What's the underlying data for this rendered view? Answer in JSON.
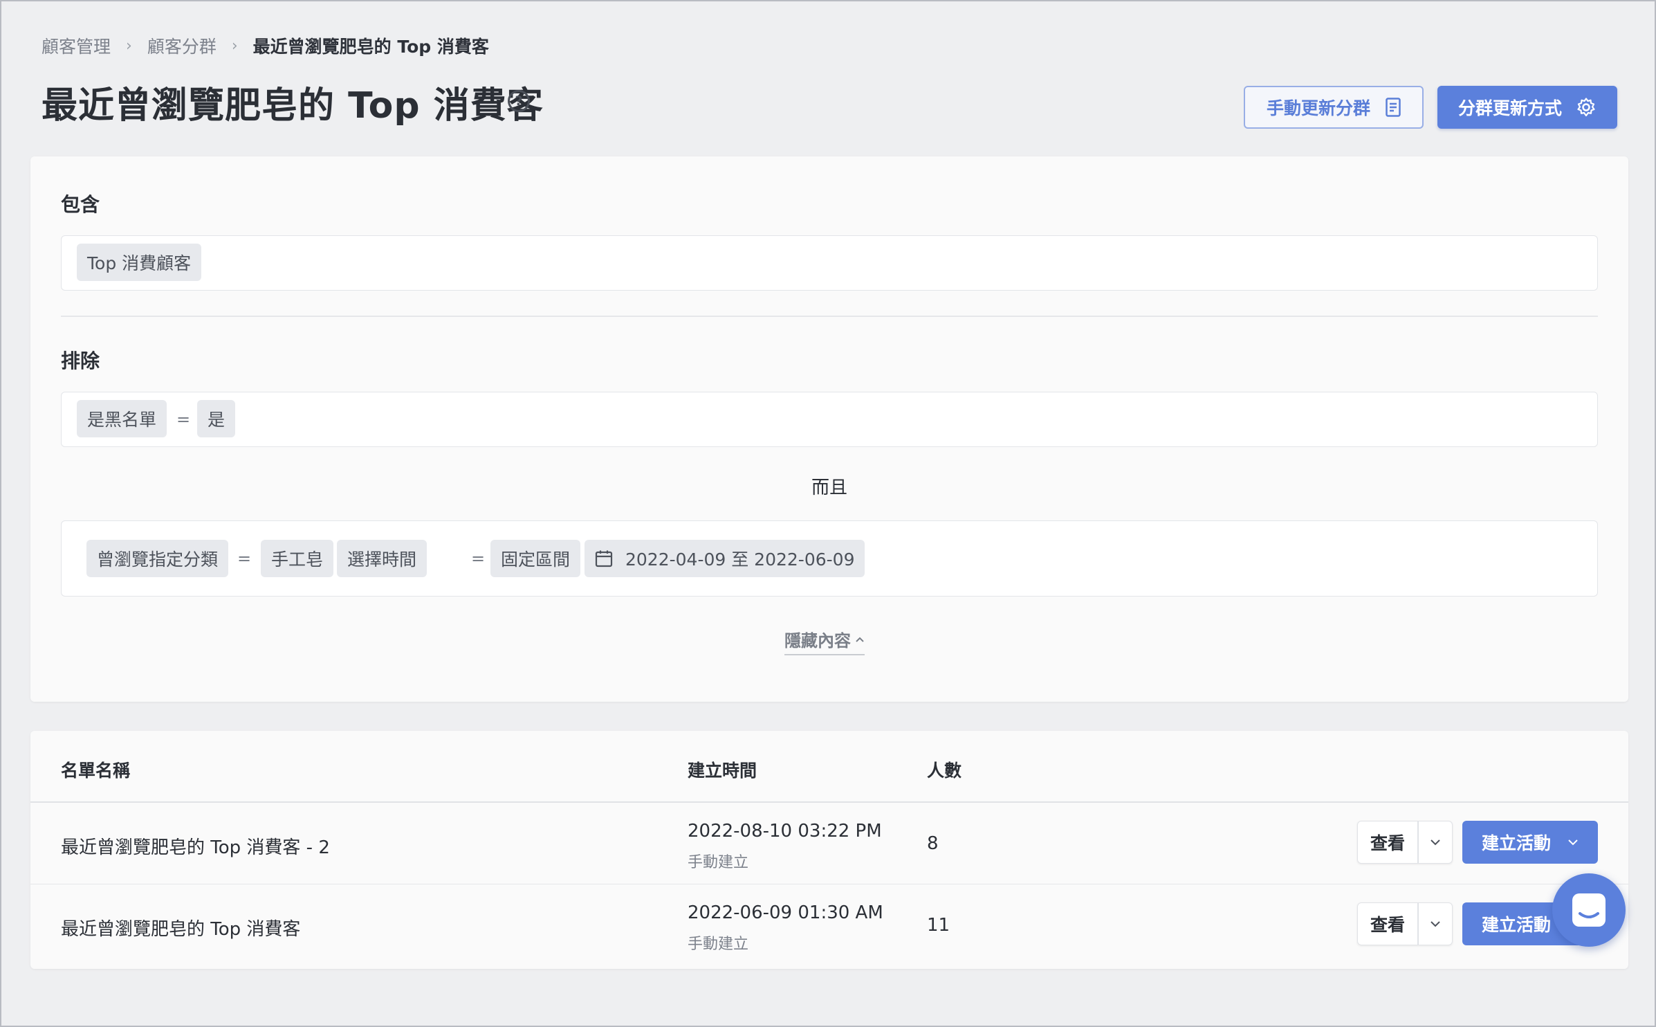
{
  "breadcrumb": {
    "items": [
      "顧客管理",
      "顧客分群",
      "最近曾瀏覽肥皂的 Top 消費客"
    ]
  },
  "header": {
    "title": "最近曾瀏覽肥皂的 Top 消費客",
    "help_icon": "?",
    "manual_update_label": "手動更新分群",
    "update_method_label": "分群更新方式"
  },
  "conditions": {
    "include": {
      "label": "包含",
      "tags": [
        "Top 消費顧客"
      ]
    },
    "exclude": {
      "label": "排除",
      "rule1": {
        "field": "是黑名單",
        "op": "=",
        "value": "是"
      },
      "connector": "而且",
      "rule2": {
        "field": "曾瀏覽指定分類",
        "op1": "=",
        "value": "手工皂",
        "time_field": "選擇時間",
        "op2": "=",
        "time_value": "固定區間",
        "date_range": "2022-04-09 至 2022-06-09"
      }
    },
    "hide_label": "隱藏內容"
  },
  "table": {
    "columns": {
      "name": "名單名稱",
      "created": "建立時間",
      "count": "人數"
    },
    "rows": [
      {
        "name": "最近曾瀏覽肥皂的 Top 消費客 - 2",
        "created": "2022-08-10 03:22 PM",
        "source": "手動建立",
        "count": "8"
      },
      {
        "name": "最近曾瀏覽肥皂的 Top 消費客",
        "created": "2022-06-09 01:30 AM",
        "source": "手動建立",
        "count": "11"
      }
    ],
    "view_label": "查看",
    "create_label": "建立活動"
  },
  "colors": {
    "accent": "#5b80dc",
    "background": "#eeeff1"
  },
  "icons": [
    "chevron-right-icon",
    "help-circle-icon",
    "document-icon",
    "gear-icon",
    "calendar-icon",
    "chevron-up-icon",
    "chevron-down-icon",
    "chat-icon"
  ]
}
